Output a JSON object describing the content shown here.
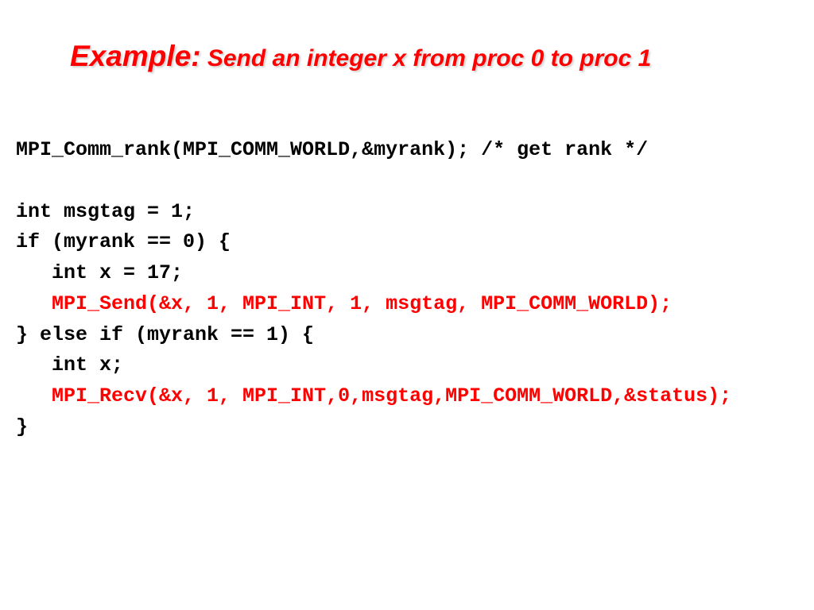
{
  "title": {
    "label": "Example:",
    "rest": "  Send an integer x from proc 0 to proc 1"
  },
  "code": {
    "l1": "MPI_Comm_rank(MPI_COMM_WORLD,&myrank); /* get rank */",
    "l2": "int msgtag = 1;",
    "l3": "if (myrank == 0) {",
    "l4": "   int x = 17;",
    "l5": "   MPI_Send(&x, 1, MPI_INT, 1, msgtag, MPI_COMM_WORLD);",
    "l6": "} else if (myrank == 1) {",
    "l7": "   int x;",
    "l8": "   MPI_Recv(&x, 1, MPI_INT,0,msgtag,MPI_COMM_WORLD,&status);",
    "l9": "}"
  }
}
